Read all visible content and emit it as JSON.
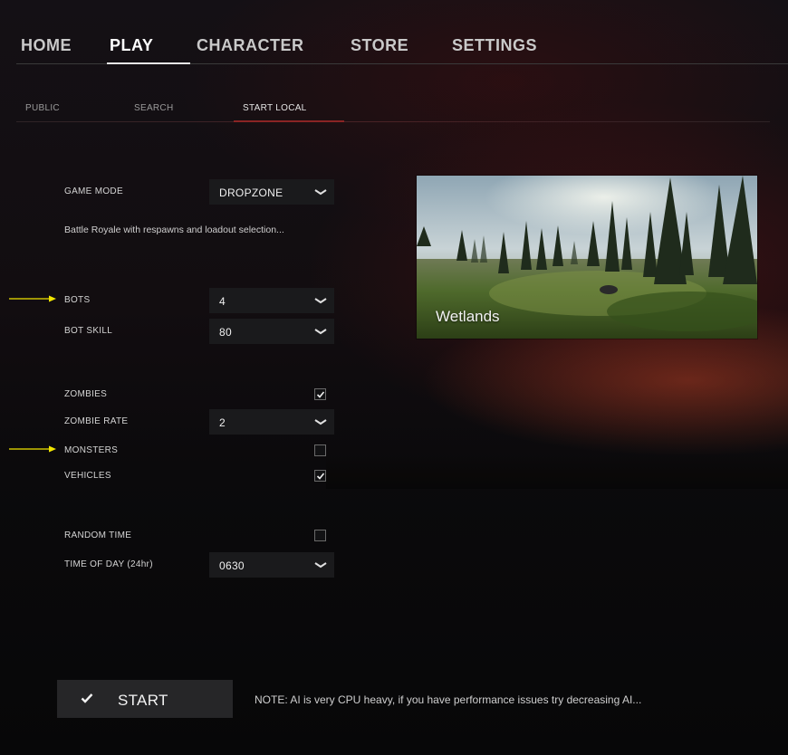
{
  "top_nav": {
    "tabs": [
      {
        "label": "HOME"
      },
      {
        "label": "PLAY"
      },
      {
        "label": "CHARACTER"
      },
      {
        "label": "STORE"
      },
      {
        "label": "SETTINGS"
      }
    ],
    "active": "PLAY"
  },
  "sub_nav": {
    "tabs": [
      {
        "label": "PUBLIC"
      },
      {
        "label": "SEARCH"
      },
      {
        "label": "START LOCAL"
      }
    ],
    "active": "START LOCAL"
  },
  "settings": {
    "game_mode": {
      "label": "GAME MODE",
      "value": "DROPZONE"
    },
    "game_mode_description": "Battle Royale with respawns and loadout selection...",
    "bots": {
      "label": "BOTS",
      "value": "4"
    },
    "bot_skill": {
      "label": "BOT SKILL",
      "value": "80"
    },
    "zombies": {
      "label": "ZOMBIES",
      "checked": true
    },
    "zombie_rate": {
      "label": "ZOMBIE RATE",
      "value": "2"
    },
    "monsters": {
      "label": "MONSTERS",
      "checked": false
    },
    "vehicles": {
      "label": "VEHICLES",
      "checked": true
    },
    "random_time": {
      "label": "RANDOM TIME",
      "checked": false
    },
    "time_of_day": {
      "label": "TIME OF DAY (24hr)",
      "value": "0630"
    }
  },
  "map_preview": {
    "name": "Wetlands"
  },
  "footer": {
    "start_label": "START",
    "note": "NOTE: AI is very CPU heavy, if you have performance issues try decreasing AI..."
  },
  "colors": {
    "accent_red": "#8a2424",
    "annotation_arrow": "#f2e600"
  }
}
